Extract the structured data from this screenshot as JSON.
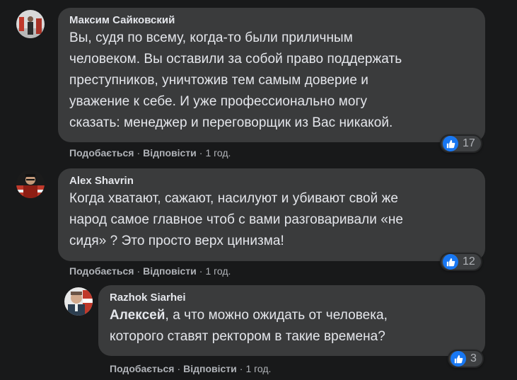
{
  "comments": [
    {
      "author": "Максим Сайковский",
      "lines": [
        "Вы, судя по всему, когда-то были приличным",
        "человеком. Вы оставили за собой право поддержать",
        "преступников, уничтожив тем самым доверие и",
        "уважение к себе. И уже профессионально могу",
        "сказать: менеджер и переговорщик из Вас никакой."
      ],
      "reactions": "17",
      "like_label": "Подобається",
      "reply_label": "Відповісти",
      "time": "1 год."
    },
    {
      "author": "Alex Shavrin",
      "lines": [
        "Когда хватают, сажают, насилуют и убивают свой же",
        "народ самое главное чтоб с вами разговаривали «не",
        "сидя» ? Это просто верх цинизма!"
      ],
      "reactions": "12",
      "like_label": "Подобається",
      "reply_label": "Відповісти",
      "time": "1 год."
    },
    {
      "author": "Razhok Siarhei",
      "mention": "Алексей",
      "line1_rest": ", а что можно ожидать от человека,",
      "line2": "которого ставят ректором в такие времена?",
      "reactions": "3",
      "like_label": "Подобається",
      "reply_label": "Відповісти",
      "time": "1 год."
    }
  ],
  "colors": {
    "background": "#18191a",
    "bubble": "#3a3b3c",
    "like_blue": "#1877f2",
    "muted": "#b0b3b8"
  }
}
